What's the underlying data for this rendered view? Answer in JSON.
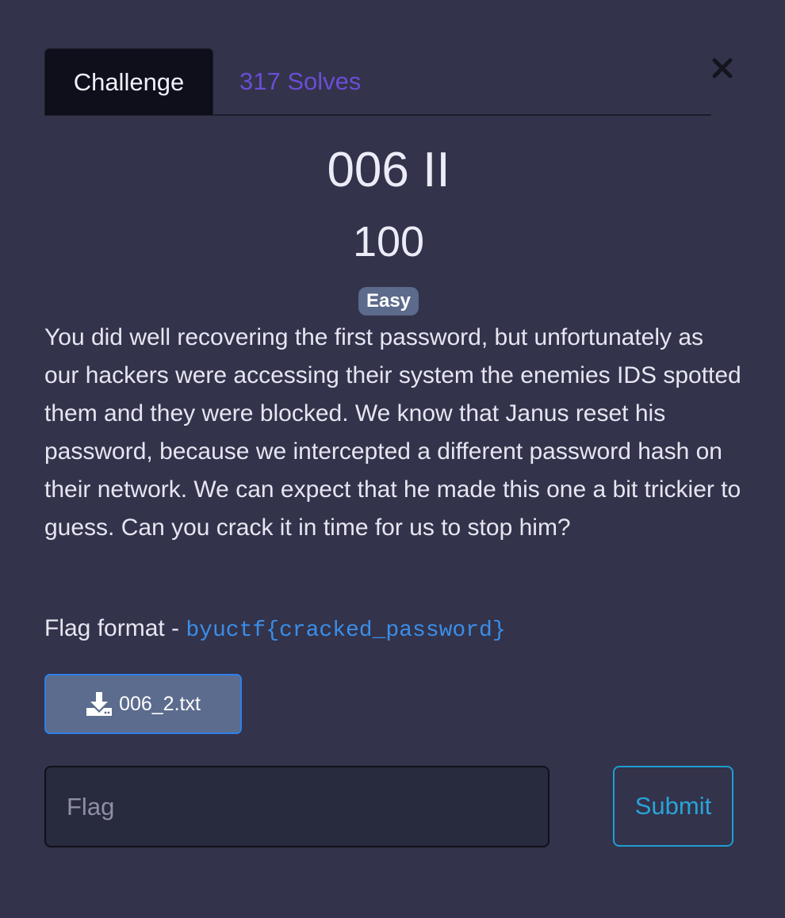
{
  "tabs": {
    "challenge_label": "Challenge",
    "solves_label": "317 Solves"
  },
  "challenge": {
    "name": "006 II",
    "points": "100",
    "difficulty": "Easy",
    "description": "You did well recovering the first password, but unfortunately as our hackers were accessing their system the enemies IDS spotted them and they were blocked. We know that Janus reset his password, because we intercepted a different password hash on their network. We can expect that he made this one a bit trickier to guess. Can you crack it in time for us to stop him?",
    "flag_format_label": "Flag format - ",
    "flag_format_code": "byuctf{cracked_password}",
    "file_name": "006_2.txt"
  },
  "form": {
    "flag_placeholder": "Flag",
    "submit_label": "Submit"
  },
  "icons": {
    "close": "close-icon",
    "download": "download-icon"
  },
  "colors": {
    "background": "#33334b",
    "solves_tab": "#6a4ed4",
    "badge": "#5c6a8b",
    "code": "#3b8ee8",
    "submit": "#1e9ed3"
  }
}
